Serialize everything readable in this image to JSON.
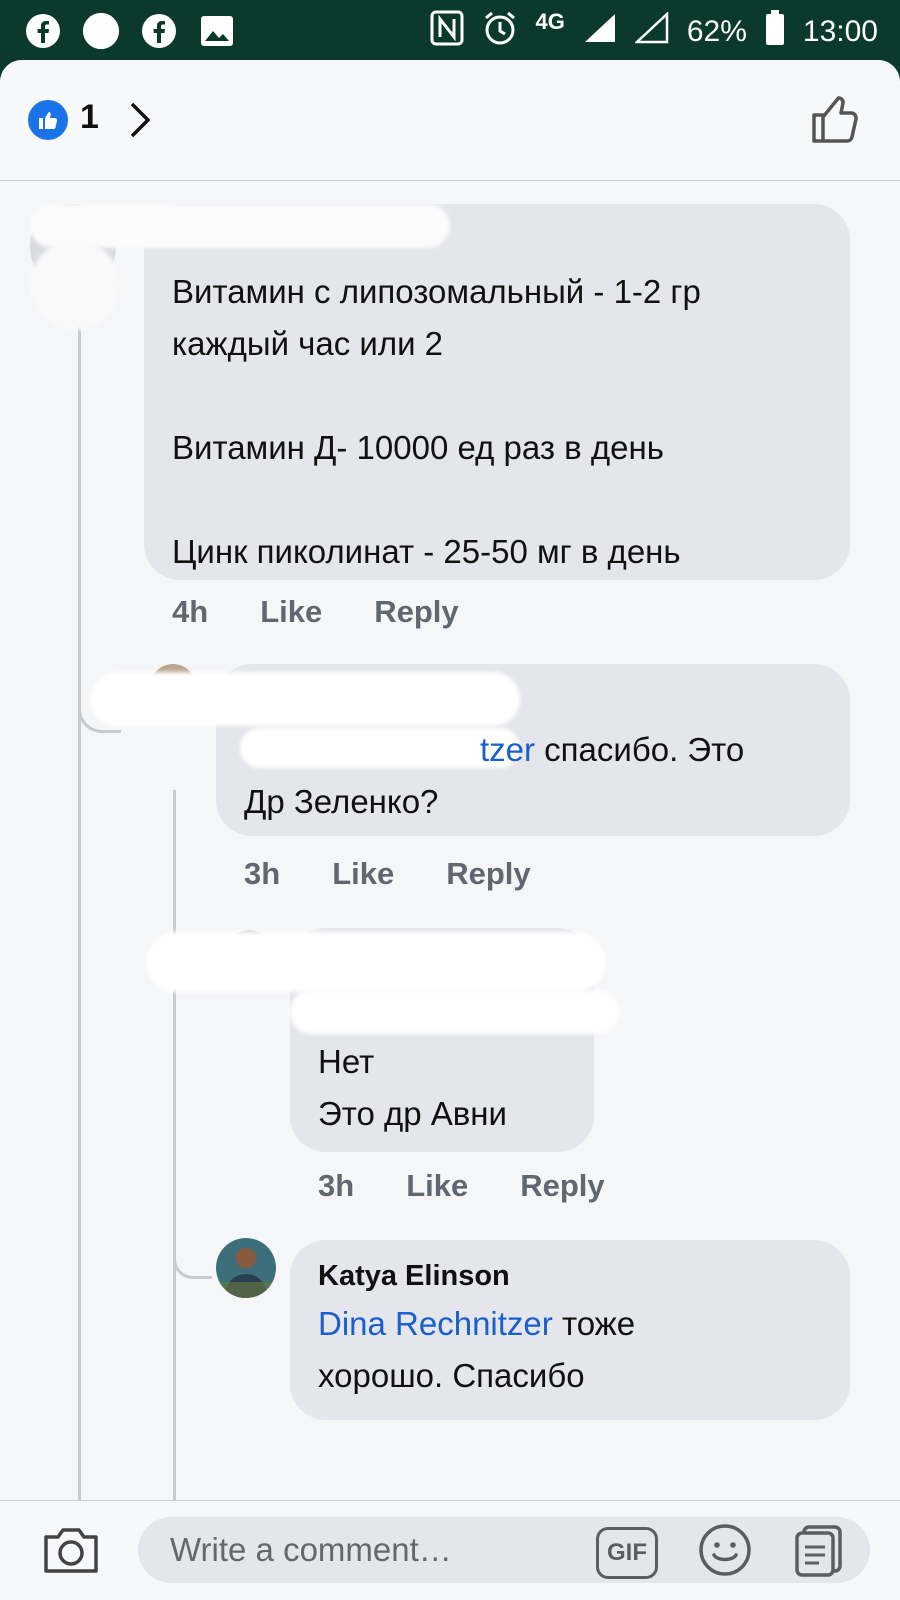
{
  "status_bar": {
    "network": "4G",
    "battery": "62%",
    "time": "13:00"
  },
  "header": {
    "like_count": "1"
  },
  "comments": [
    {
      "lines": [
        "Витамин с липозомальный - 1-2 гр",
        "каждый час или 2",
        "",
        "Витамин Д- 10000 ед раз в день",
        "",
        "Цинк пиколинат - 25-50 мг в день"
      ],
      "time": "4h",
      "like": "Like",
      "reply": "Reply"
    },
    {
      "mention_suffix": "tzer",
      "text_after_mention": " спасибо. Это",
      "line2": "Др Зеленко?",
      "time": "3h",
      "like": "Like",
      "reply": "Reply"
    },
    {
      "line1": "Нет",
      "line2": "Это др Авни",
      "time": "3h",
      "like": "Like",
      "reply": "Reply"
    },
    {
      "author": "Katya Elinson",
      "mention": "Dina Rechnitzer",
      "text_after_mention": " тоже",
      "line2": "хорошо. Спасибо"
    }
  ],
  "composer": {
    "placeholder": "Write a comment…",
    "gif_label": "GIF"
  },
  "colors": {
    "status_bar_bg": "#0b3a2c",
    "accent_blue": "#1b5fcc",
    "bubble_bg": "#e4e6eb"
  }
}
